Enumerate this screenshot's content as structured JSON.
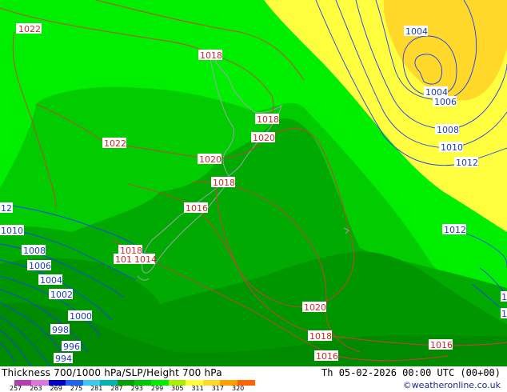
{
  "map": {
    "isobars_red": [
      {
        "label": "1022",
        "lon_lat_text": "nw"
      },
      {
        "label": "1018"
      },
      {
        "label": "1018"
      },
      {
        "label": "1020"
      },
      {
        "label": "1022"
      },
      {
        "label": "1020"
      },
      {
        "label": "1018"
      },
      {
        "label": "1016"
      },
      {
        "label": "1018"
      },
      {
        "label": "1016"
      },
      {
        "label": "1014"
      },
      {
        "label": "1020"
      },
      {
        "label": "1018"
      },
      {
        "label": "1016"
      },
      {
        "label": "1016"
      }
    ],
    "isobars_blue": [
      {
        "label": "1004"
      },
      {
        "label": "1004"
      },
      {
        "label": "1006"
      },
      {
        "label": "1008"
      },
      {
        "label": "1010"
      },
      {
        "label": "1012"
      },
      {
        "label": "1012"
      },
      {
        "label": "12"
      },
      {
        "label": "1010"
      },
      {
        "label": "1008"
      },
      {
        "label": "1006"
      },
      {
        "label": "1004"
      },
      {
        "label": "1002"
      },
      {
        "label": "1000"
      },
      {
        "label": "998"
      },
      {
        "label": "996"
      },
      {
        "label": "994"
      },
      {
        "label": "1"
      },
      {
        "label": "1"
      }
    ],
    "colors": {
      "yellow": "#ffff40",
      "yellow_dark": "#ffd82a",
      "green_bright": "#00ee00",
      "green_mid": "#00cc00",
      "green_dark": "#00aa00",
      "green_darker": "#009600",
      "red_line": "#d23c3c",
      "blue_line": "#1a3cff",
      "coast": "#a0a0b4"
    }
  },
  "footer": {
    "title_left": "Thickness 700/1000 hPa/SLP/Height 700 hPa",
    "title_right": "Th 05-02-2026 00:00 UTC (00+00)",
    "credit": "©weatheronline.co.uk",
    "scale_ticks": [
      "257",
      "263",
      "269",
      "275",
      "281",
      "287",
      "293",
      "299",
      "305",
      "311",
      "317",
      "320"
    ],
    "scale_colors": [
      "#b43cb4",
      "#dc78dc",
      "#0000c8",
      "#1e64f0",
      "#3cc8f0",
      "#00b4b4",
      "#00a000",
      "#00c800",
      "#00ee00",
      "#aaee00",
      "#ffff40",
      "#ffd82a",
      "#ffa000",
      "#ff6400"
    ]
  }
}
